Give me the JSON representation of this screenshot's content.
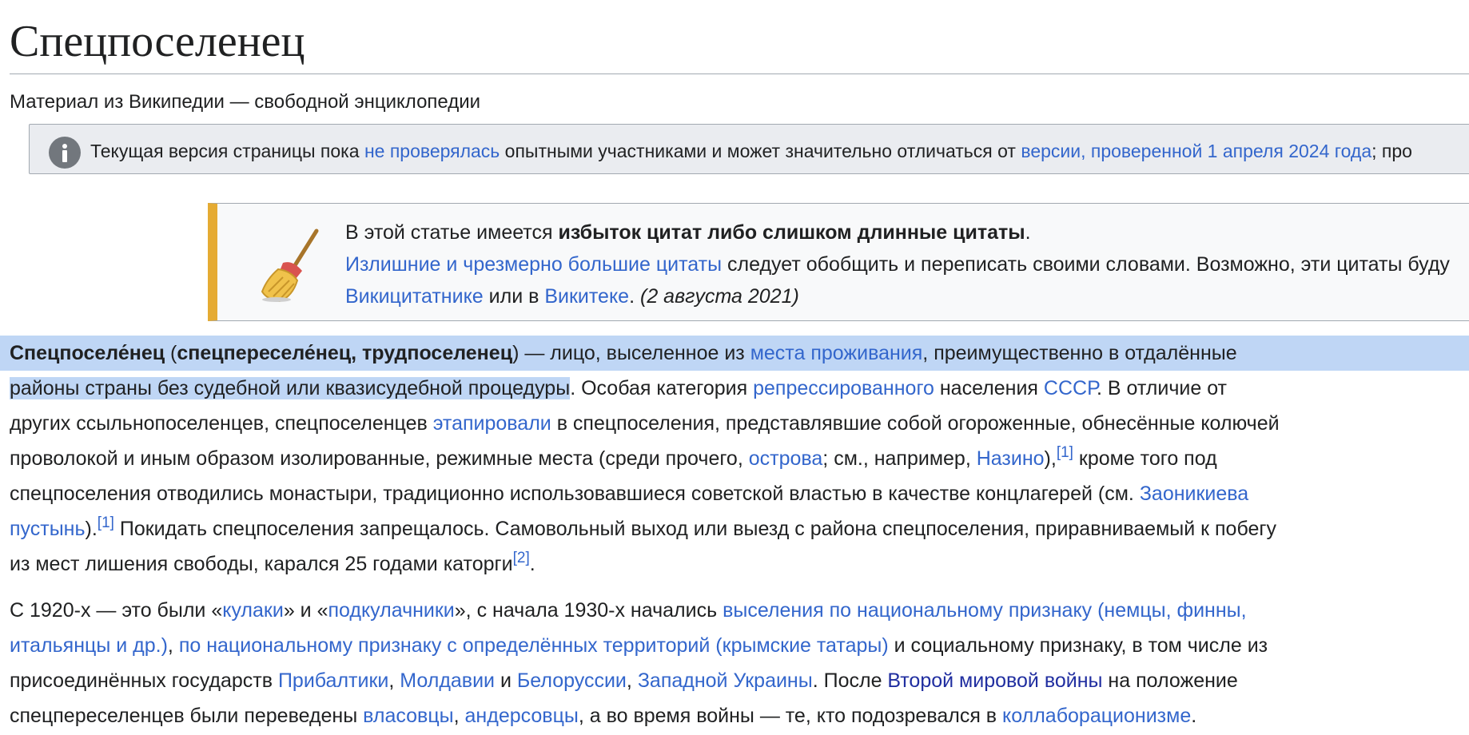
{
  "page": {
    "title": "Спецпоселенец",
    "subtitle": "Материал из Википедии — свободной энциклопедии"
  },
  "notice": {
    "icon": "info-icon",
    "t1": "Текущая версия страницы пока ",
    "link1": "не проверялась",
    "t2": " опытными участниками и может значительно отличаться от ",
    "link2": "версии, проверенной 1 апреля 2024 года",
    "t3": "; про"
  },
  "ambox": {
    "icon": "broom-icon",
    "accent_color": "#e5ab33",
    "l1_t1": "В этой статье имеется ",
    "l1_bold": "избыток цитат либо слишком длинные цитаты",
    "l1_t2": ".",
    "l2_link": "Излишние и чрезмерно большие цитаты",
    "l2_t": " следует обобщить и переписать своими словами. Возможно, эти цитаты буду",
    "l3_link1": "Викицитатнике",
    "l3_t1": " или в ",
    "l3_link2": "Викитеке",
    "l3_t2": ". ",
    "l3_date": "(2 августа 2021)"
  },
  "p1": {
    "l1_b1": "Спецпоселе́нец",
    "l1_t1": " (",
    "l1_b2": "спецпереселе́нец, трудпоселенец",
    "l1_t2": ") — лицо, выселенное из ",
    "l1_link1": "места проживания",
    "l1_t3": ", преимущественно в отдалённые",
    "l2_hl": "районы страны без судебной или квазисудебной процедуры",
    "l2_t1": ". Особая категория ",
    "l2_link1": "репрессированного",
    "l2_t2": " населения ",
    "l2_link2": "СССР",
    "l2_t3": ". В отличие от",
    "l3_t1": "других ссыльнопоселенцев, спецпоселенцев ",
    "l3_link1": "этапировали",
    "l3_t2": " в спецпоселения, представлявшие собой огороженные, обнесённые колючей",
    "l4_t1": "проволокой и иным образом изолированные, режимные места (среди прочего, ",
    "l4_link1": "острова",
    "l4_t2": "; см., например, ",
    "l4_link2": "Назино",
    "l4_t3": "),",
    "l4_ref": "[1]",
    "l4_t4": " кроме того под",
    "l5_t1": "спецпоселения отводились монастыри, традиционно использовавшиеся советской властью в качестве концлагерей (см. ",
    "l5_link1": "Заоникиева",
    "l6_link1": "пустынь",
    "l6_t1": ").",
    "l6_ref": "[1]",
    "l6_t2": " Покидать спецпоселения запрещалось. Самовольный выход или выезд с района спецпоселения, приравниваемый к побегу",
    "l7_t1": "из мест лишения свободы, карался 25 годами каторги",
    "l7_ref": "[2]",
    "l7_t2": "."
  },
  "p2": {
    "l1_t1": "С 1920-х — это были «",
    "l1_link1": "кулаки",
    "l1_t2": "» и «",
    "l1_link2": "подкулачники",
    "l1_t3": "», с начала 1930-х начались ",
    "l1_link3": "выселения по национальному признаку (немцы, финны,",
    "l2_link1": "итальянцы и др.)",
    "l2_t1": ", ",
    "l2_link2": "по национальному признаку с определённых территорий (крымские татары)",
    "l2_t2": " и социальному признаку, в том числе из",
    "l3_t1": "присоединённых государств ",
    "l3_link1": "Прибалтики",
    "l3_t2": ", ",
    "l3_link2": "Молдавии",
    "l3_t3": " и ",
    "l3_link3": "Белоруссии",
    "l3_t4": ", ",
    "l3_link4": "Западной Украины",
    "l3_t5": ". После ",
    "l3_link5": "Второй мировой войны",
    "l3_t6": " на положение",
    "l4_t1": "спецпереселенцев были переведены ",
    "l4_link1": "власовцы",
    "l4_t2": ", ",
    "l4_link2": "андерсовцы",
    "l4_t3": ", а во время войны — те, кто подозревался в ",
    "l4_link3": "коллаборационизме",
    "l4_t4": "."
  }
}
